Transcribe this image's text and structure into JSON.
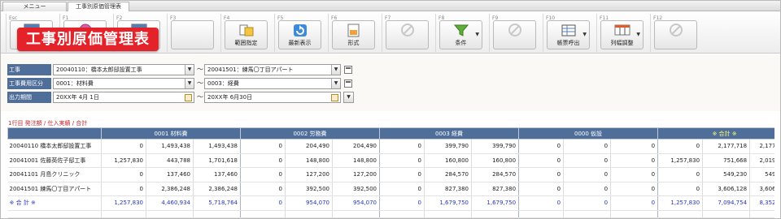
{
  "tabs": [
    {
      "label": "メニュー"
    },
    {
      "label": "工事別原価管理表"
    }
  ],
  "title_badge": "工事別原価管理表",
  "toolbar": [
    {
      "fkey": "Esc",
      "label": "",
      "icon": "window-icon"
    },
    {
      "fkey": "F1",
      "label": "",
      "icon": "help-icon"
    },
    {
      "fkey": "F2",
      "label": "",
      "icon": "window-icon"
    },
    {
      "fkey": "F3",
      "label": "",
      "icon": "blank-icon"
    },
    {
      "fkey": "F4",
      "label": "範囲指定",
      "icon": "range-icon"
    },
    {
      "fkey": "F5",
      "label": "最新表示",
      "icon": "refresh-icon"
    },
    {
      "fkey": "F6",
      "label": "形式",
      "icon": "format-icon"
    },
    {
      "fkey": "F7",
      "label": "",
      "icon": "disabled-icon"
    },
    {
      "fkey": "F8",
      "label": "条件",
      "icon": "filter-icon",
      "dropdown": true
    },
    {
      "fkey": "F9",
      "label": "",
      "icon": "disabled-icon"
    },
    {
      "fkey": "F10",
      "label": "帳票呼出",
      "icon": "report-icon",
      "dropdown": true
    },
    {
      "fkey": "F11",
      "label": "列幅調整",
      "icon": "columns-icon",
      "dropdown": true
    },
    {
      "fkey": "F12",
      "label": "",
      "icon": "disabled-icon"
    }
  ],
  "filters": {
    "construction": {
      "label": "工事",
      "from": "20040110：橋本太郎邸設置工事",
      "to": "20041501：練馬〇丁目アパート"
    },
    "cost_category": {
      "label": "工事費用区分",
      "from": "0001：材料費",
      "to": "0003：経費"
    },
    "output_period": {
      "label": "出力期間",
      "from": "20XX年 4月 1日",
      "to": "20XX年 6月30日"
    },
    "separator": "〜"
  },
  "crumb": "1行目 発注額 / 仕入実績 / 合計",
  "table": {
    "headers": [
      "",
      "0001 材料費",
      "0002 労務費",
      "0003 経費",
      "0000 仮設",
      "※ 合計 ※"
    ],
    "rows": [
      {
        "name": "20040110 橋本太郎邸設置工事",
        "cells": [
          "0",
          "1,493,438",
          "1,493,438",
          "0",
          "204,490",
          "204,490",
          "0",
          "399,790",
          "399,790",
          "0",
          "0",
          "0",
          "0",
          "2,177,718",
          "2,177,718"
        ]
      },
      {
        "name": "20041001 佐藤英佐子邸工事",
        "cells": [
          "1,257,830",
          "443,788",
          "1,701,618",
          "0",
          "148,800",
          "148,800",
          "0",
          "160,800",
          "160,800",
          "0",
          "0",
          "0",
          "1,257,830",
          "751,668",
          "2,019,498"
        ]
      },
      {
        "name": "20041101 月島クリニック",
        "cells": [
          "0",
          "137,460",
          "137,460",
          "0",
          "127,200",
          "127,200",
          "0",
          "284,570",
          "284,570",
          "0",
          "0",
          "0",
          "0",
          "549,230",
          "549,230"
        ]
      },
      {
        "name": "20041501 練馬〇丁目アパート",
        "cells": [
          "0",
          "2,386,248",
          "2,386,248",
          "0",
          "392,500",
          "392,500",
          "0",
          "827,380",
          "827,380",
          "0",
          "0",
          "0",
          "0",
          "3,606,128",
          "3,606,128"
        ]
      }
    ],
    "total": {
      "name": "※ 合 計 ※",
      "cells": [
        "1,257,830",
        "4,460,934",
        "5,718,764",
        "0",
        "954,070",
        "954,070",
        "0",
        "1,679,750",
        "1,679,750",
        "0",
        "0",
        "0",
        "1,257,830",
        "7,094,754",
        "8,352,584"
      ]
    }
  }
}
